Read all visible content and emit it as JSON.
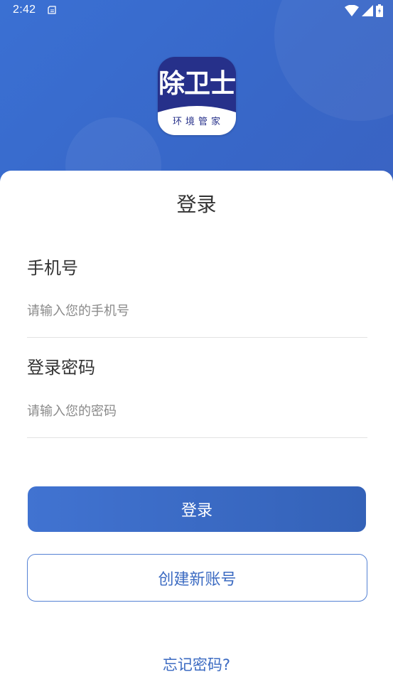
{
  "status_bar": {
    "time": "2:42",
    "icons": [
      "notification-icon",
      "wifi-icon",
      "cell-signal-icon",
      "battery-icon"
    ]
  },
  "logo": {
    "title": "除卫士",
    "subtitle": "环境管家",
    "colors": {
      "background": "#26308a",
      "band": "#ffffff"
    }
  },
  "login": {
    "title": "登录",
    "phone": {
      "label": "手机号",
      "placeholder": "请输入您的手机号",
      "value": ""
    },
    "password": {
      "label": "登录密码",
      "placeholder": "请输入您的密码",
      "value": ""
    },
    "submit_label": "登录",
    "register_label": "创建新账号",
    "forgot_label": "忘记密码?"
  },
  "colors": {
    "primary": "#3c6bc2",
    "header_background": "#3a6bce",
    "text": "#333333",
    "placeholder": "#8a8a8a",
    "divider": "#e3e3e3"
  }
}
